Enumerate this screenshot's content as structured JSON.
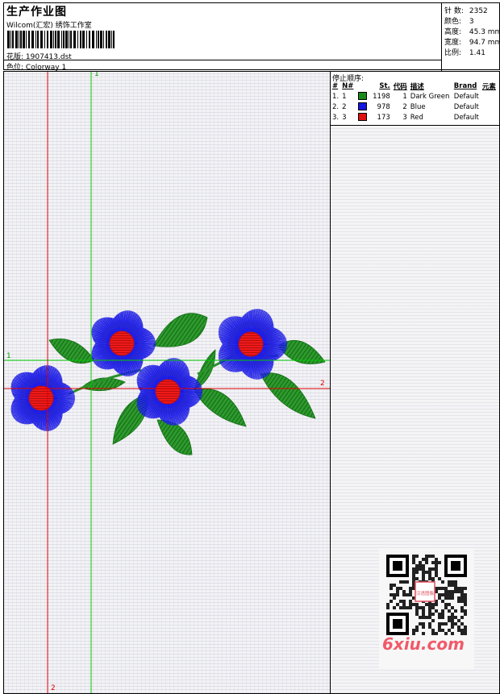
{
  "header": {
    "title": "生产作业图",
    "company": "Wilcom(汇宏) 绣饰工作室",
    "design_label": "花版:",
    "design_value": "1907413.dst",
    "colorway_label": "色位:",
    "colorway_value": "Colorway 1"
  },
  "stats": [
    {
      "label": "针 数:",
      "value": "2352"
    },
    {
      "label": "颜色:",
      "value": "3"
    },
    {
      "label": "高度:",
      "value": "45.3 mm"
    },
    {
      "label": "宽度:",
      "value": "94.7 mm"
    },
    {
      "label": "比例:",
      "value": "1.41"
    }
  ],
  "stop_sequence": {
    "title": "停止顺序:",
    "columns": [
      "#",
      "N#",
      "St.",
      "代码",
      "描述",
      "Brand",
      "元素"
    ],
    "rows": [
      {
        "num": "1.",
        "n": "1",
        "color": "#1a8a1a",
        "stitches": "1198",
        "code": "1",
        "desc": "Dark Green",
        "brand": "Default"
      },
      {
        "num": "2.",
        "n": "2",
        "color": "#1515e0",
        "stitches": "978",
        "code": "2",
        "desc": "Blue",
        "brand": "Default"
      },
      {
        "num": "3.",
        "n": "3",
        "color": "#e01010",
        "stitches": "173",
        "code": "3",
        "desc": "Red",
        "brand": "Default"
      }
    ]
  },
  "guides": {
    "green_v": "1",
    "green_h": "1",
    "red_h": "2",
    "red_v": "2"
  },
  "watermark": "6xiu.com",
  "qr_text": "汉语图像",
  "colors": {
    "green": "#1a8a1a",
    "blue": "#1515e0",
    "red": "#e01010",
    "guide_green": "#00c800",
    "guide_red": "#e00000"
  }
}
